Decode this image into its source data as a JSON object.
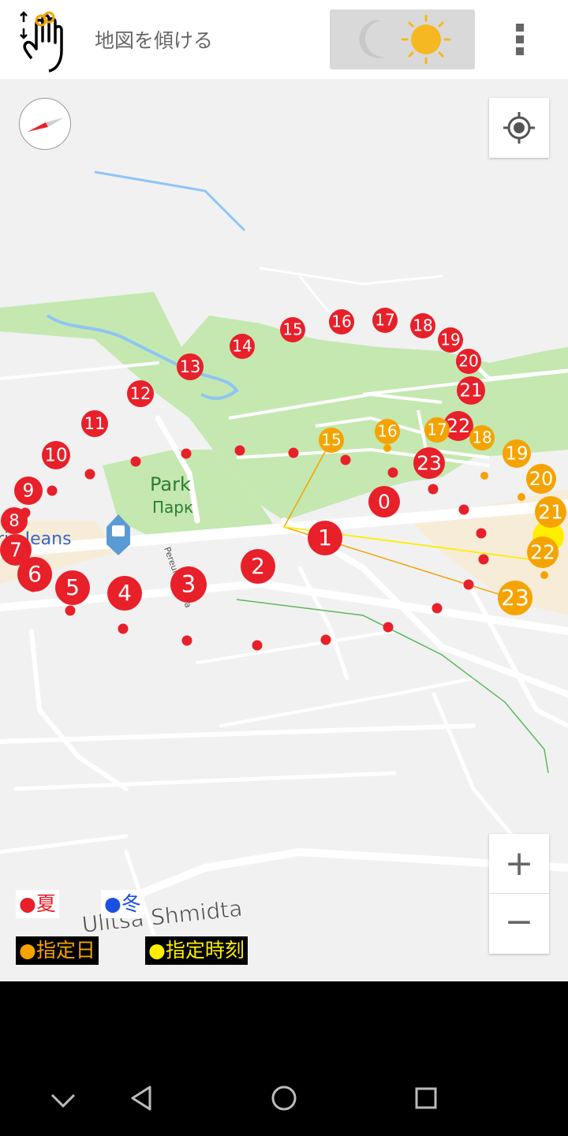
{
  "toolbar": {
    "title": "地図を傾ける",
    "tilt_icon": "hand-swipe-icon",
    "day_night_icons": [
      "moon-icon",
      "sun-icon"
    ],
    "menu_icon": "more-vert-icon"
  },
  "map": {
    "labels": {
      "park_en": "Park",
      "park_ru": "Парк",
      "shop": "ria Jeans",
      "street_main": "Ulitsa Shmidta",
      "street_small": "Pereulok ...ova"
    },
    "sun_path_summer_hours": [
      "0",
      "1",
      "2",
      "3",
      "4",
      "5",
      "6",
      "7",
      "8",
      "9",
      "10",
      "11",
      "12",
      "13",
      "14",
      "15",
      "16",
      "17",
      "18",
      "19",
      "20",
      "21",
      "22",
      "23"
    ],
    "sun_path_date_hours": [
      "15",
      "16",
      "17",
      "18",
      "19",
      "20",
      "21",
      "22",
      "23"
    ],
    "colors": {
      "summer": "#e8202a",
      "winter": "#1a4fe0",
      "specified_date": "#f5a300",
      "specified_time": "#ffee00",
      "park": "#c4e8b0",
      "water": "#8ec5f5"
    }
  },
  "legend": {
    "summer": "●夏",
    "winter": "●冬",
    "specified_date": "●指定日",
    "specified_time": "●指定時刻"
  },
  "controls": {
    "zoom_in": "+",
    "zoom_out": "−",
    "compass_icon": "compass-icon",
    "my_location_icon": "my-location-icon"
  },
  "navbar": {
    "icons": [
      "chevron-down-icon",
      "back-icon",
      "home-icon",
      "recents-icon"
    ]
  }
}
